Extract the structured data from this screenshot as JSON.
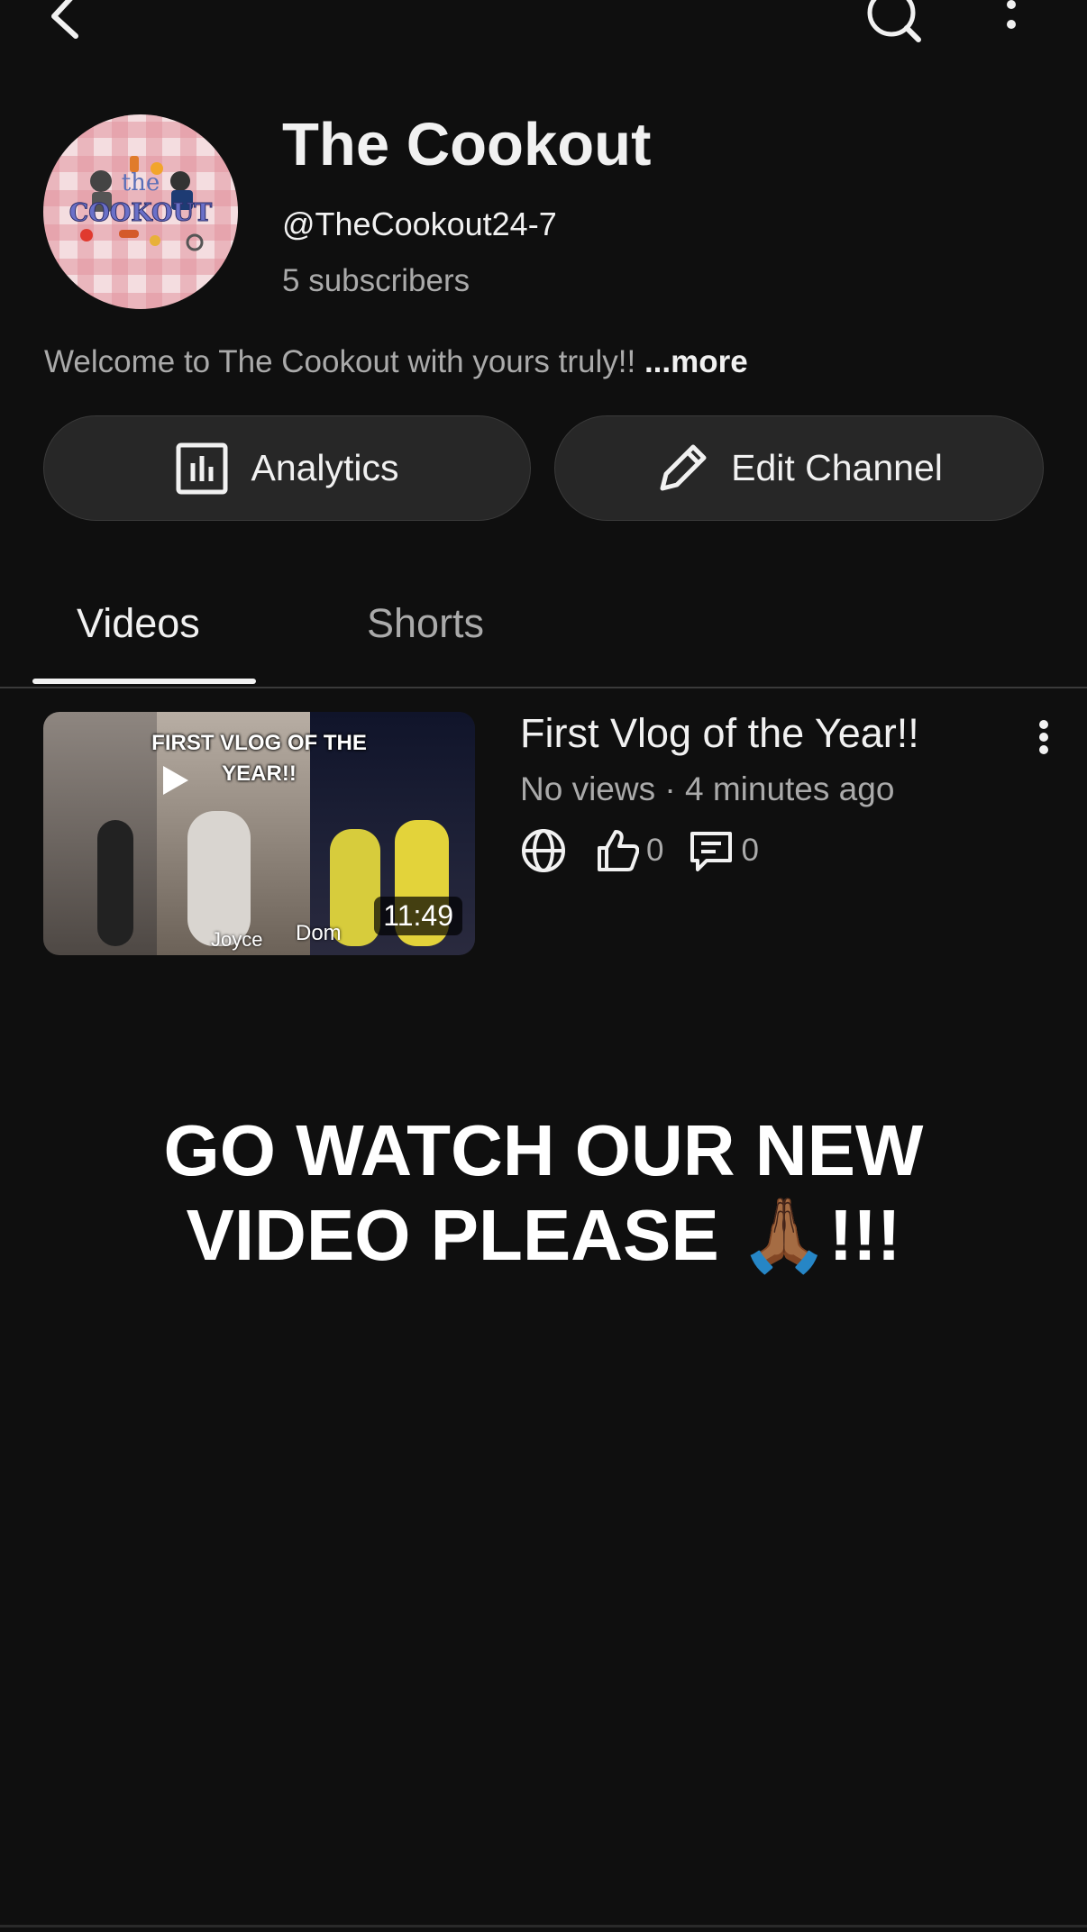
{
  "topbar": {
    "back_icon": "chevron-left-icon",
    "search_icon": "search-icon",
    "more_icon": "more-vertical-icon"
  },
  "channel": {
    "avatar_text_top": "the",
    "avatar_text_main": "COOKOUT",
    "title": "The Cookout",
    "handle": "@TheCookout24-7",
    "subscribers": "5 subscribers",
    "description": "Welcome to The Cookout with yours truly!!",
    "more_label": "...more"
  },
  "buttons": {
    "analytics_label": "Analytics",
    "edit_label": "Edit Channel"
  },
  "tabs": [
    {
      "label": "Videos",
      "active": true
    },
    {
      "label": "Shorts",
      "active": false
    }
  ],
  "video": {
    "thumbnail_caption_1": "FIRST VLOG OF THE",
    "thumbnail_caption_2": "YEAR!!",
    "thumbnail_name_1": "Joyce",
    "thumbnail_name_2": "Dom",
    "duration": "11:49",
    "title": "First Vlog of the Year!!",
    "meta": "No views · 4 minutes ago",
    "likes": "0",
    "comments": "0",
    "visibility_icon": "globe-icon"
  },
  "promo": {
    "line1": "GO WATCH OUR NEW",
    "line2": "VIDEO PLEASE 🙏🏾!!!"
  },
  "colors": {
    "background": "#0f0f0f",
    "pill": "#272727",
    "secondary_text": "#aaaaaa"
  }
}
